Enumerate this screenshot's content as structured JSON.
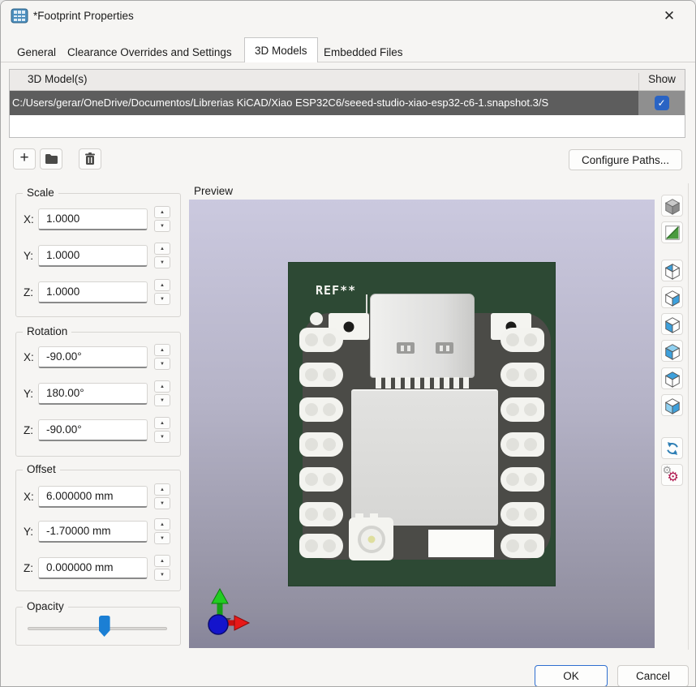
{
  "window": {
    "title": "*Footprint Properties"
  },
  "icons": {
    "close": "✕",
    "add": "+",
    "spin_up": "▲",
    "spin_down": "▼",
    "check": "✓",
    "gear": "⚙"
  },
  "tabs": [
    {
      "label": "General",
      "active": false
    },
    {
      "label": "Clearance Overrides and Settings",
      "active": false
    },
    {
      "label": "3D Models",
      "active": true
    },
    {
      "label": "Embedded Files",
      "active": false
    }
  ],
  "model_table": {
    "header_models": "3D Model(s)",
    "header_show": "Show",
    "rows": [
      {
        "path": "C:/Users/gerar/OneDrive/Documentos/Librerias KiCAD/Xiao ESP32C6/seeed-studio-xiao-esp32-c6-1.snapshot.3/S",
        "show": true,
        "selected": true
      }
    ]
  },
  "model_toolbar": {
    "add_icon": "add-model-icon",
    "folder_icon": "browse-folder-icon",
    "delete_icon": "delete-model-icon",
    "configure_paths_label": "Configure Paths..."
  },
  "scale": {
    "title": "Scale",
    "rows": [
      {
        "label": "X:",
        "value": "1.0000"
      },
      {
        "label": "Y:",
        "value": "1.0000"
      },
      {
        "label": "Z:",
        "value": "1.0000"
      }
    ]
  },
  "rotation": {
    "title": "Rotation",
    "rows": [
      {
        "label": "X:",
        "value": "-90.00°"
      },
      {
        "label": "Y:",
        "value": "180.00°"
      },
      {
        "label": "Z:",
        "value": "-90.00°"
      }
    ]
  },
  "offset": {
    "title": "Offset",
    "rows": [
      {
        "label": "X:",
        "value": "6.000000 mm"
      },
      {
        "label": "Y:",
        "value": "-1.70000 mm"
      },
      {
        "label": "Z:",
        "value": "0.000000 mm"
      }
    ]
  },
  "opacity": {
    "title": "Opacity",
    "value_percent": 55
  },
  "preview": {
    "label": "Preview",
    "silkscreen_ref": "REF**",
    "colors": {
      "background_top": "#cbc9df",
      "background_bottom": "#86849a",
      "board_green": "#2d4934",
      "module_gray": "#4b4b47",
      "pad_white": "#f3f3ef"
    }
  },
  "view_toolbar_icons": [
    "view-axonometric-icon",
    "board-body-icon",
    "view-back-icon",
    "view-right-icon",
    "view-left-icon",
    "view-front-icon",
    "view-top-icon",
    "view-bottom-icon",
    "reload-model-icon",
    "rotation-settings-icon"
  ],
  "footer": {
    "ok_label": "OK",
    "cancel_label": "Cancel"
  },
  "accent": {
    "selection_bg": "#5d5d5d",
    "checkbox_blue": "#2a64c4",
    "slider_blue": "#1b7fd4",
    "default_button_border": "#2f6fd0",
    "cube_face_blue": "#3da0dc"
  }
}
